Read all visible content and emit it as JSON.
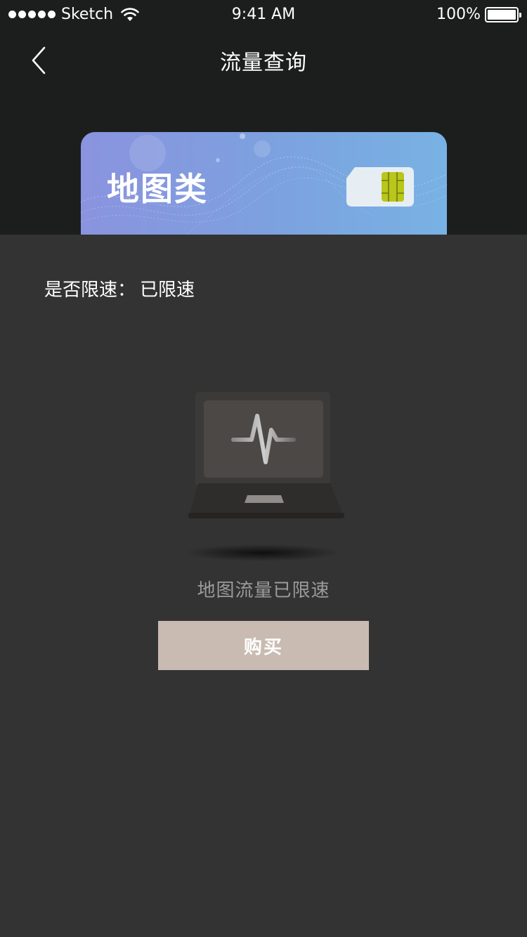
{
  "status_bar": {
    "carrier": "Sketch",
    "time": "9:41 AM",
    "battery_percent": "100%"
  },
  "nav": {
    "title": "流量查询",
    "back_icon": "chevron-left-icon"
  },
  "card": {
    "title": "地图类",
    "icon": "sim-card-icon"
  },
  "speed_limit": {
    "label": "是否限速：",
    "value": "已限速"
  },
  "empty_state": {
    "icon": "laptop-pulse-icon",
    "message": "地图流量已限速"
  },
  "buy_button": {
    "label": "购买"
  },
  "colors": {
    "top_bg": "#1c1d1d",
    "body_bg": "#323332",
    "button_bg": "#c9bbb2",
    "card_gradient_start": "#8a93df",
    "card_gradient_end": "#78b2e4"
  }
}
